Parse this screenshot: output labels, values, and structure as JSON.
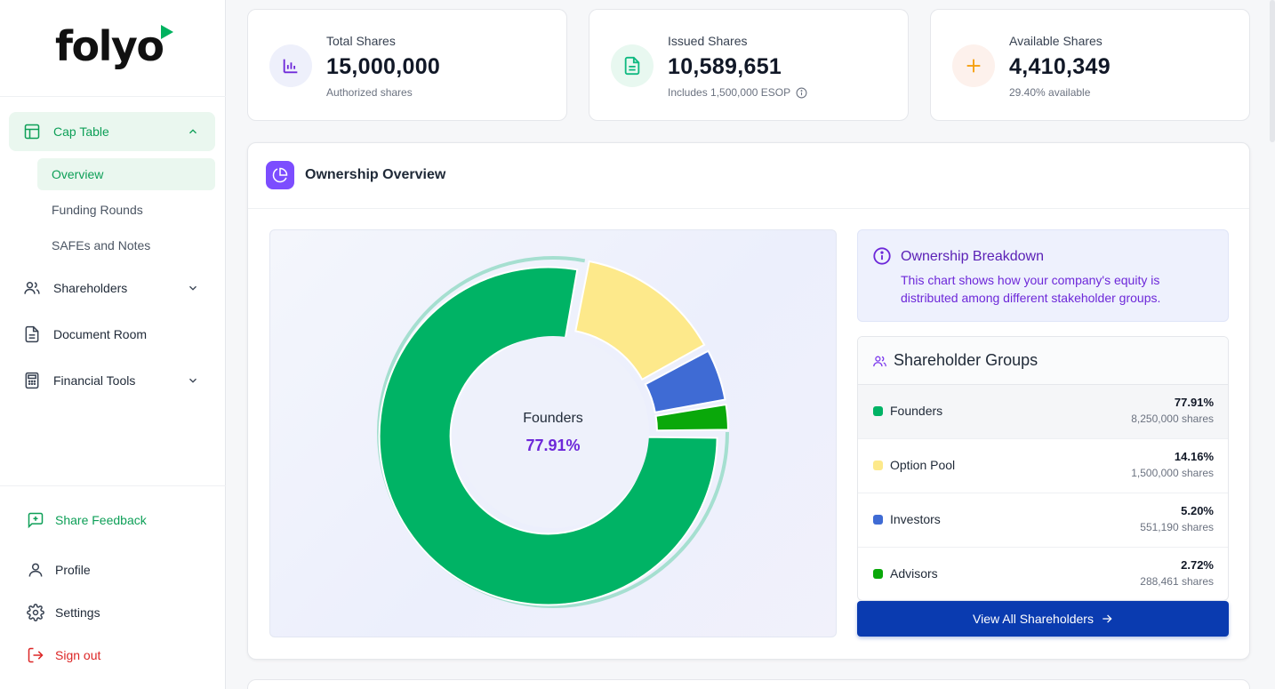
{
  "app": {
    "logo": "folyo",
    "brand_color": "#00b25f"
  },
  "sidebar": {
    "nav": [
      {
        "label": "Cap Table",
        "icon": "table-icon",
        "expanded": true
      },
      {
        "label": "Shareholders",
        "icon": "users-icon"
      },
      {
        "label": "Document Room",
        "icon": "document-icon"
      },
      {
        "label": "Financial Tools",
        "icon": "calculator-icon"
      }
    ],
    "subnav": [
      {
        "label": "Overview",
        "active": true
      },
      {
        "label": "Funding Rounds"
      },
      {
        "label": "SAFEs and Notes"
      }
    ],
    "bottom": {
      "feedback": "Share Feedback",
      "profile": "Profile",
      "settings": "Settings",
      "signout": "Sign out"
    }
  },
  "stats": [
    {
      "label": "Total Shares",
      "value": "15,000,000",
      "sub": "Authorized shares",
      "icon": "bar-chart-icon",
      "color": "#6d28d9"
    },
    {
      "label": "Issued Shares",
      "value": "10,589,651",
      "sub": "Includes 1,500,000 ESOP",
      "icon": "document-icon",
      "color": "#10b981"
    },
    {
      "label": "Available Shares",
      "value": "4,410,349",
      "sub": "29.40% available",
      "icon": "plus-icon",
      "color": "#f59e0b"
    }
  ],
  "ownership": {
    "title": "Ownership Overview",
    "center_label": "Founders",
    "center_value": "77.91%",
    "breakdown_title": "Ownership Breakdown",
    "breakdown_text": "This chart shows how your company's equity is distributed among different stakeholder groups.",
    "groups_title": "Shareholder Groups",
    "view_all": "View All Shareholders"
  },
  "chart_data": {
    "type": "pie",
    "categories": [
      "Founders",
      "Option Pool",
      "Investors",
      "Advisors"
    ],
    "values": [
      77.91,
      14.16,
      5.2,
      2.72
    ],
    "shares": [
      "8,250,000 shares",
      "1,500,000 shares",
      "551,190 shares",
      "288,461 shares"
    ],
    "percent_labels": [
      "77.91%",
      "14.16%",
      "5.20%",
      "2.72%"
    ],
    "colors": [
      "#00b365",
      "#fde98b",
      "#3f6bd4",
      "#0aa80a"
    ],
    "highlighted": "Founders",
    "donut": true
  }
}
